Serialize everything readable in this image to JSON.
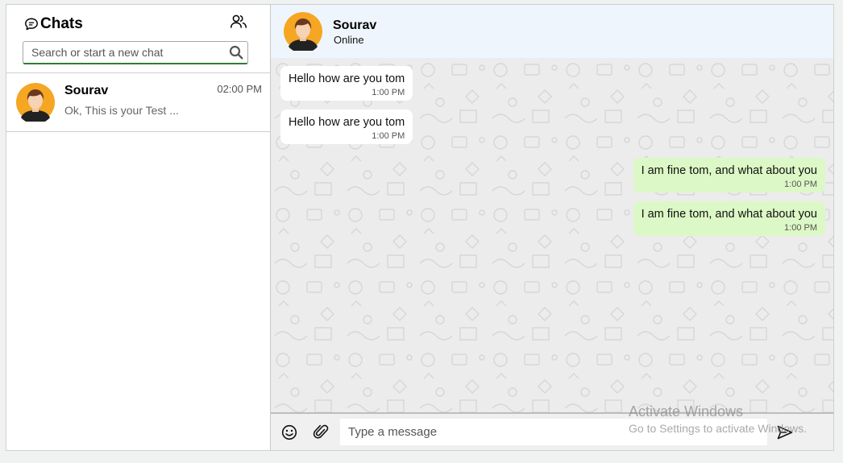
{
  "sidebar": {
    "title": "Chats",
    "search": {
      "placeholder": "Search or start a new chat",
      "value": ""
    },
    "chats": [
      {
        "name": "Sourav",
        "time": "02:00 PM",
        "preview": "Ok, This is your Test ..."
      }
    ]
  },
  "header": {
    "name": "Sourav",
    "status": "Online"
  },
  "messages": [
    {
      "direction": "in",
      "text": "Hello how are you tom",
      "time": "1:00 PM"
    },
    {
      "direction": "in",
      "text": "Hello how are you tom",
      "time": "1:00 PM"
    },
    {
      "direction": "out",
      "text": "I am fine tom, and what about you",
      "time": "1:00 PM"
    },
    {
      "direction": "out",
      "text": "I am fine tom, and what about you",
      "time": "1:00 PM"
    }
  ],
  "composer": {
    "placeholder": "Type a message",
    "value": ""
  },
  "watermark": {
    "line1": "Activate Windows",
    "line2": "Go to Settings to activate Windows."
  },
  "icons": [
    "chat-bubble-icon",
    "group-icon",
    "search-icon",
    "emoji-icon",
    "attach-icon",
    "send-icon"
  ],
  "colors": {
    "header_bg": "#eef5fc",
    "outgoing_bubble": "#dcf8c6",
    "incoming_bubble": "#ffffff",
    "search_underline": "#2e7d32",
    "avatar_bg": "#f5a623"
  }
}
